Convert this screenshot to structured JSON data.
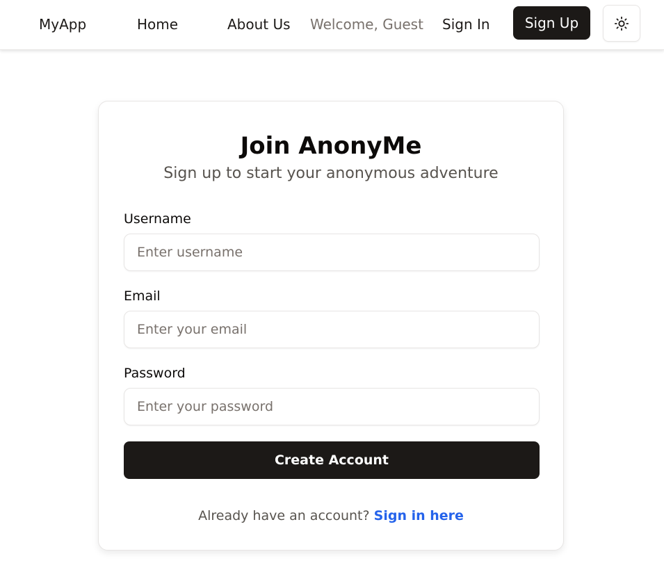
{
  "nav": {
    "brand": "MyApp",
    "home": "Home",
    "about": "About Us",
    "welcome": "Welcome, Guest",
    "sign_in": "Sign In",
    "sign_up": "Sign Up",
    "theme_icon": "sun-icon"
  },
  "card": {
    "title": "Join AnonyMe",
    "subtitle": "Sign up to start your anonymous adventure",
    "fields": [
      {
        "label": "Username",
        "value": "",
        "placeholder": "Enter username"
      },
      {
        "label": "Email",
        "value": "",
        "placeholder": "Enter your email"
      },
      {
        "label": "Password",
        "value": "",
        "placeholder": "Enter your password"
      }
    ],
    "submit": "Create Account",
    "footer_text": "Already have an account?",
    "footer_link": "Sign in here"
  },
  "colors": {
    "primary": "#1c1917",
    "link": "#2563eb",
    "muted": "#78716c"
  }
}
